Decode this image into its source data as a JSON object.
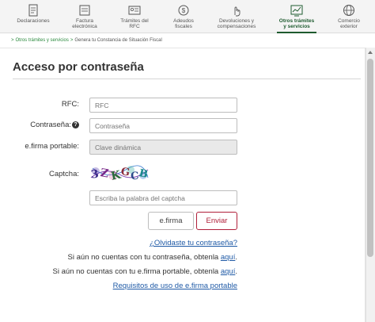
{
  "nav": {
    "items": [
      {
        "label1": "Declaraciones",
        "label2": "",
        "icon": "declaraciones-icon"
      },
      {
        "label1": "Factura",
        "label2": "electrónica",
        "icon": "factura-icon"
      },
      {
        "label1": "Trámites del",
        "label2": "RFC",
        "icon": "rfc-icon"
      },
      {
        "label1": "Adeudos",
        "label2": "fiscales",
        "icon": "adeudos-icon"
      },
      {
        "label1": "Devoluciones y",
        "label2": "compensaciones",
        "icon": "devoluciones-icon"
      },
      {
        "label1": "Otros trámites",
        "label2": "y servicios",
        "icon": "otros-tramites-icon"
      },
      {
        "label1": "Comercio",
        "label2": "exterior",
        "icon": "comercio-exterior-icon"
      }
    ],
    "active_index": 5
  },
  "breadcrumb": {
    "prefix": ">",
    "link": "Otros trámites y servicios",
    "sep": ">",
    "current": "Genera tu Constancia de Situación Fiscal"
  },
  "form": {
    "title": "Acceso por contraseña",
    "rfc_label": "RFC:",
    "rfc_placeholder": "RFC",
    "password_label": "Contraseña:",
    "password_help_icon": "?",
    "password_placeholder": "Contraseña",
    "efirma_label": "e.firma portable:",
    "efirma_placeholder": "Clave dinámica",
    "captcha_label": "Captcha:",
    "captcha_text": "3ZKGCB",
    "captcha_placeholder": "Escriba la palabra del captcha",
    "efirma_button": "e.firma",
    "submit_button": "Enviar"
  },
  "links": {
    "forgot_password": "¿Olvidaste tu contraseña?",
    "no_password_text": "Si aún no cuentas con tu contraseña, obtenla",
    "no_password_link": "aquí",
    "no_efirma_text": "Si aún no cuentas con tu e.firma portable, obtenla",
    "no_efirma_link": "aquí",
    "requirements": "Requisitos de uso de e.firma portable",
    "period": "."
  },
  "colors": {
    "brand_green": "#1e5b2f",
    "link_blue": "#1f5aa6",
    "submit_red": "#b0203a"
  }
}
